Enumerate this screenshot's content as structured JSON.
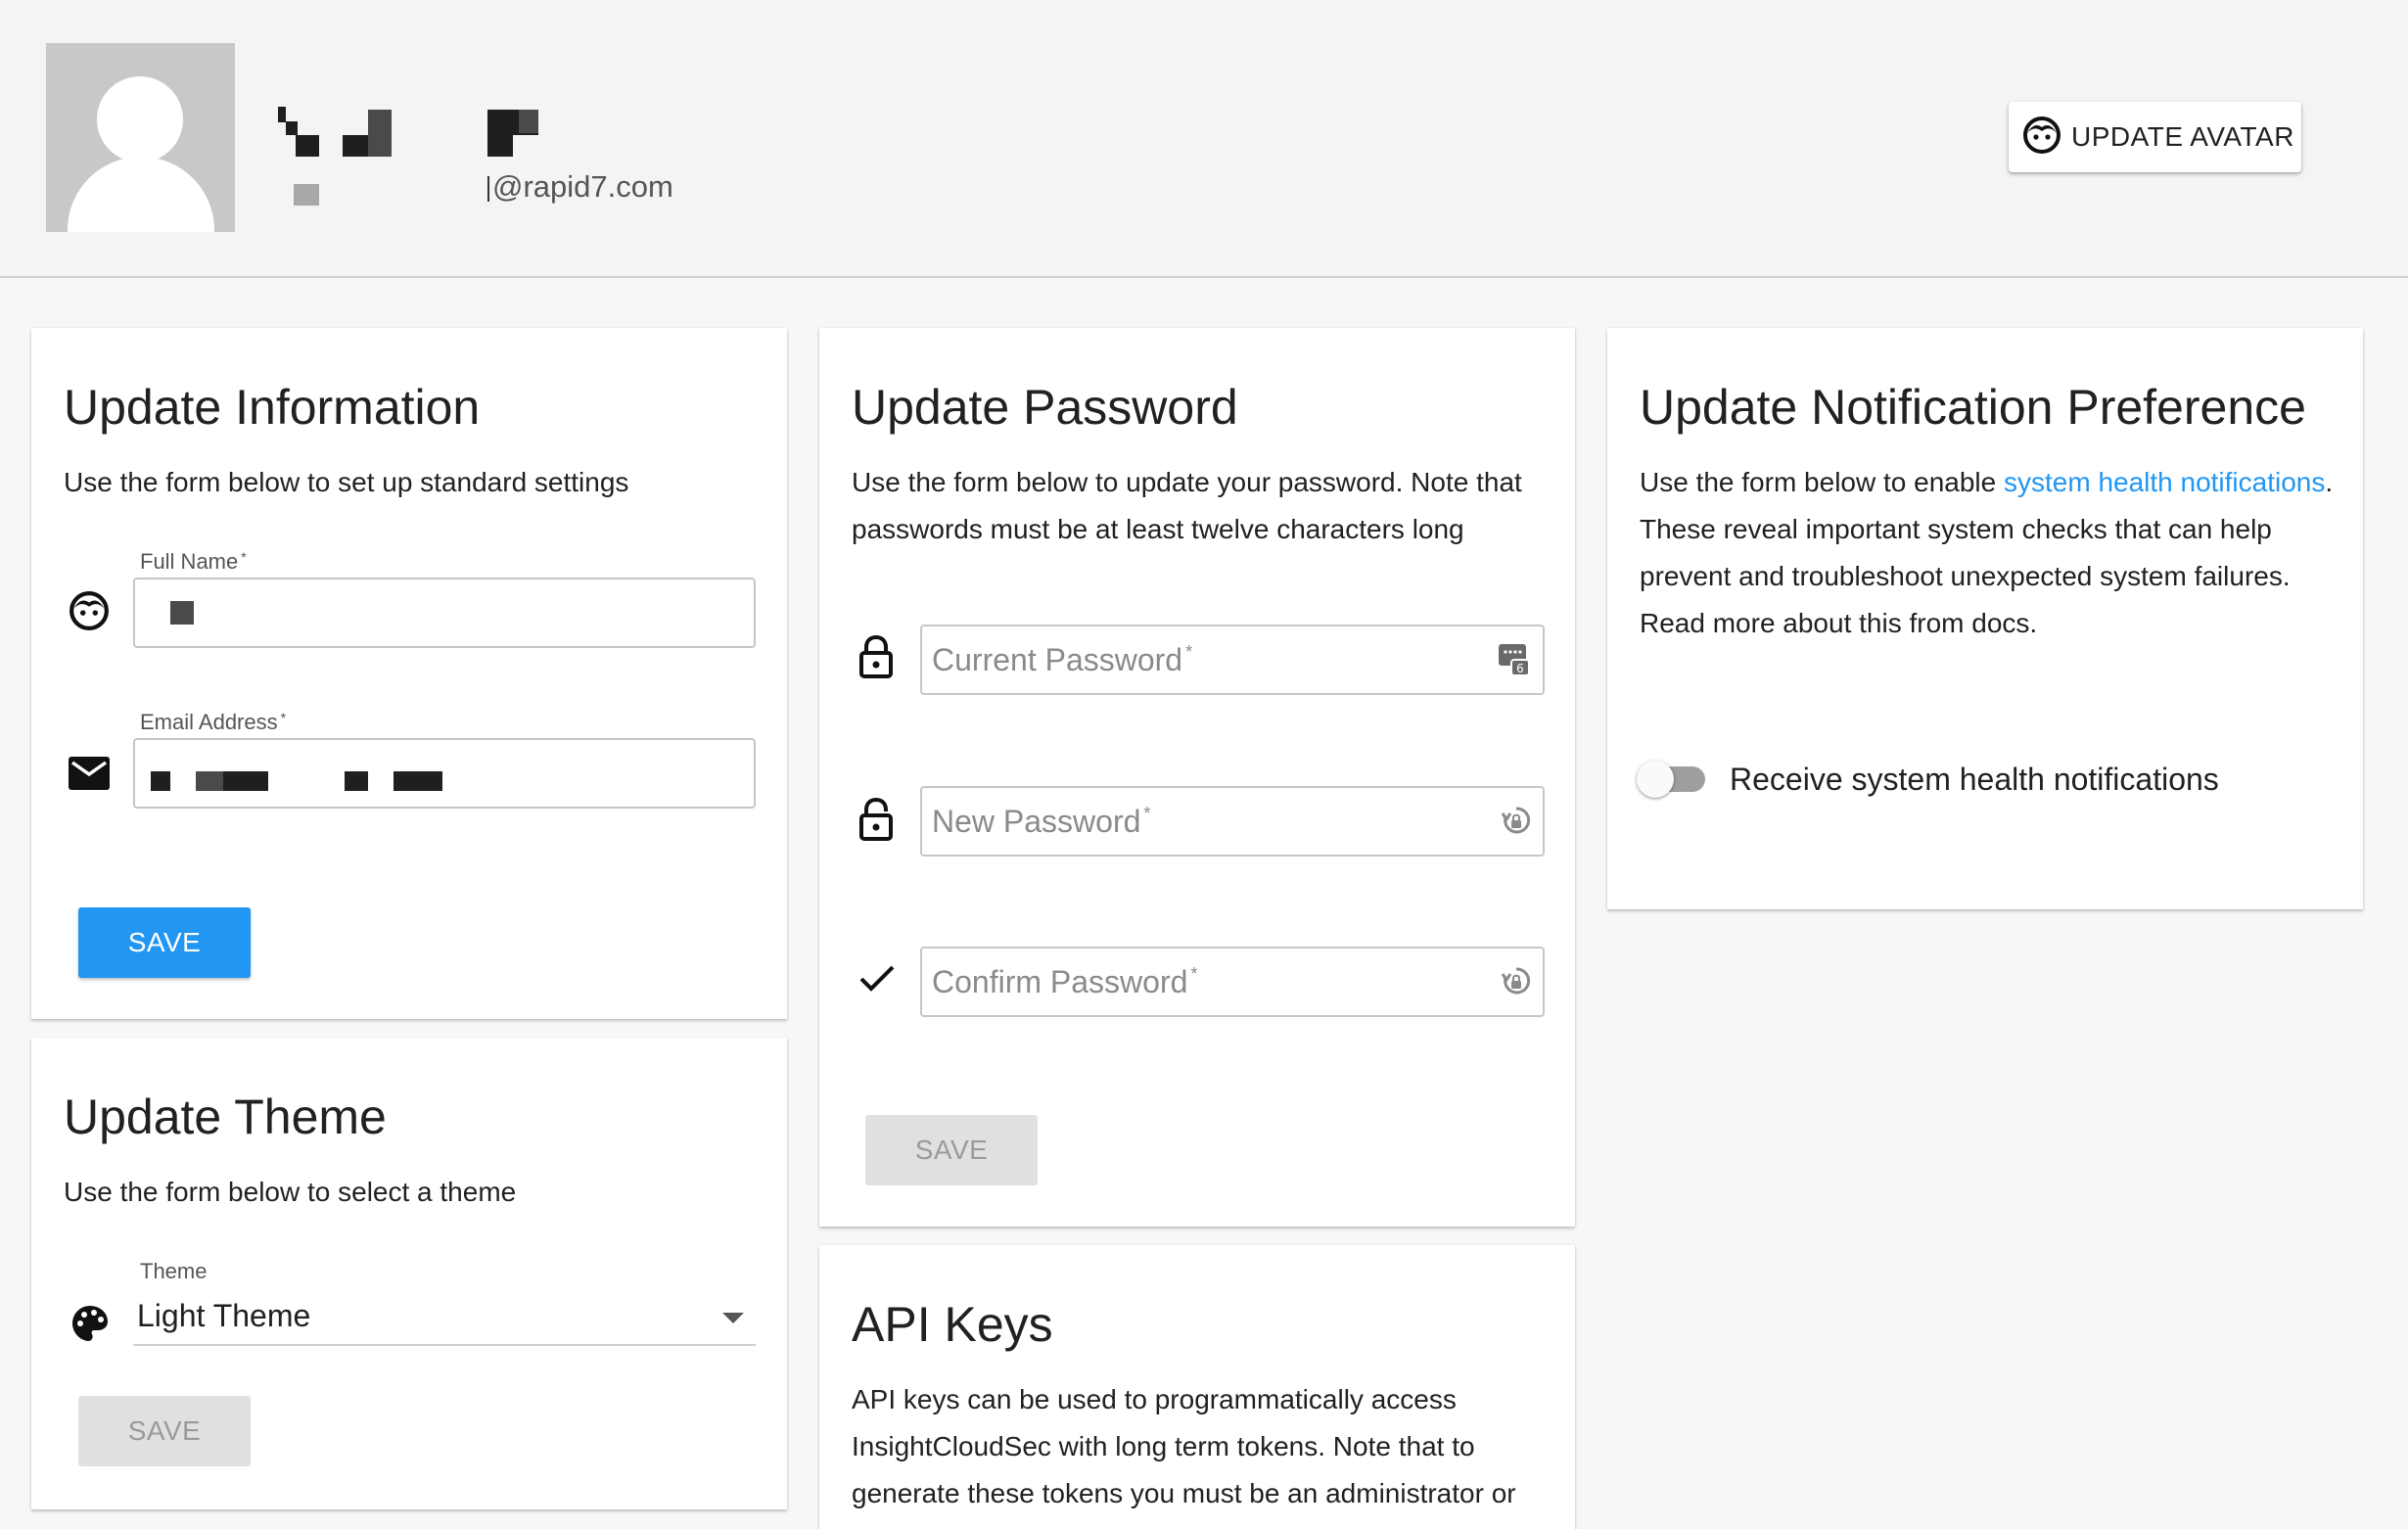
{
  "profile": {
    "email_suffix": "@rapid7.com",
    "update_avatar_label": "UPDATE AVATAR"
  },
  "update_information": {
    "title": "Update Information",
    "description": "Use the form below to set up standard settings",
    "full_name_label": "Full Name",
    "email_label": "Email Address",
    "required_mark": "*",
    "save_label": "SAVE"
  },
  "update_theme": {
    "title": "Update Theme",
    "description": "Use the form below to select a theme",
    "theme_label": "Theme",
    "theme_value": "Light Theme",
    "save_label": "SAVE"
  },
  "update_password": {
    "title": "Update Password",
    "description": "Use the form below to update your password. Note that passwords must be at least twelve characters long",
    "current_placeholder": "Current Password",
    "new_placeholder": "New Password",
    "confirm_placeholder": "Confirm Password",
    "required_mark": "*",
    "save_label": "SAVE",
    "manager_badge": "6"
  },
  "api_keys": {
    "title": "API Keys",
    "description": "API keys can be used to programmatically access InsightCloudSec with long term tokens. Note that to generate these tokens you must be an administrator or"
  },
  "notifications": {
    "title": "Update Notification Preference",
    "desc_prefix": "Use the form below to enable ",
    "desc_link": "system health notifications",
    "desc_suffix": ". These reveal important system checks that can help prevent and troubleshoot unexpected system failures. Read more about this from docs.",
    "toggle_label": "Receive system health notifications",
    "toggle_enabled": false
  },
  "colors": {
    "primary": "#2196f3",
    "link": "#2196f3",
    "disabled_button": "#e0e0e0"
  },
  "icons": [
    "user-face-icon",
    "mail-icon",
    "lock-icon",
    "lock-open-icon",
    "check-icon",
    "palette-icon",
    "password-manager-icon",
    "password-reveal-icon",
    "dropdown-caret-icon"
  ]
}
